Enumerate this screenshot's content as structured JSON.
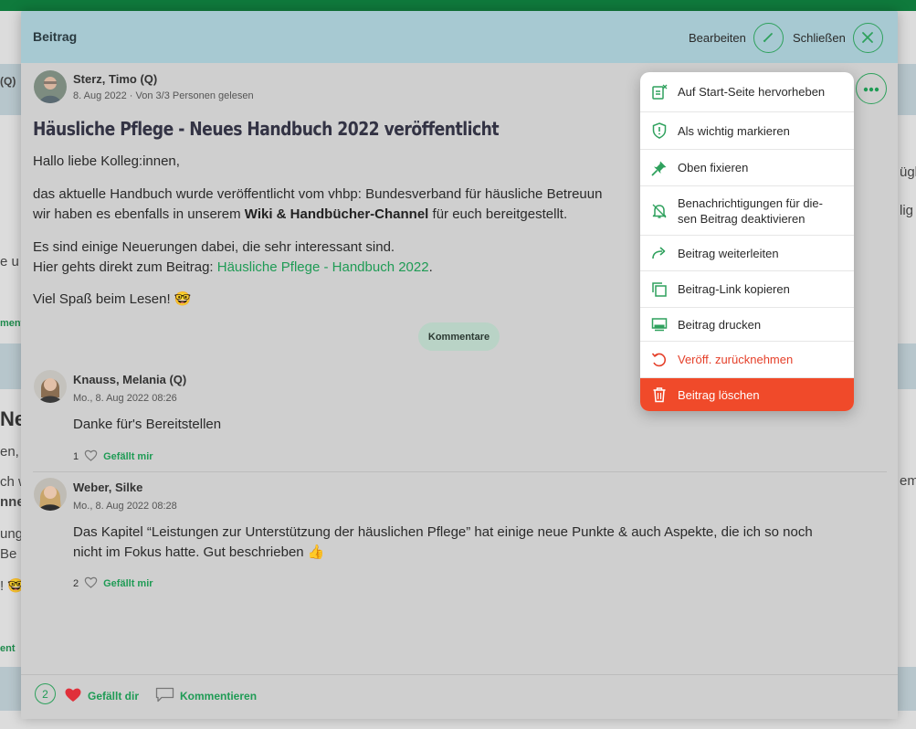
{
  "modal": {
    "title": "Beitrag",
    "edit_label": "Bearbeiten",
    "close_label": "Schließen"
  },
  "post": {
    "author": "Sterz, Timo (Q)",
    "date": "8. Aug 2022",
    "read_status": "Von 3/3 Personen gelesen",
    "headline": "Häusliche Pflege -  Neues Handbuch 2022 veröffentlicht",
    "greeting": "Hallo liebe Kolleg:innen,",
    "p1_line1": "das aktuelle Handbuch wurde veröffentlicht vom vhbp: Bundesverband für häusliche Betreuun",
    "p1_line2_pre": "wir haben es ebenfalls in unserem ",
    "p1_line2_bold": "Wiki & Handbücher-Channel",
    "p1_line2_post": " für euch bereitgestellt.",
    "p2_line1": "Es sind einige Neuerungen dabei, die sehr interessant sind.",
    "p2_line2_pre": "Hier gehts direkt zum Beitrag: ",
    "p2_link": "Häusliche Pflege -  Handbuch 2022",
    "p2_line2_post": ".",
    "closing": "Viel Spaß beim Lesen! 🤓",
    "comments_label": "Kommentare"
  },
  "comments": [
    {
      "author": "Knauss, Melania (Q)",
      "timestamp": "Mo., 8. Aug 2022 08:26",
      "text_line1": "Danke für's Bereitstellen",
      "text_line2": "",
      "likes": "1",
      "like_label": "Gefällt mir"
    },
    {
      "author": "Weber, Silke",
      "timestamp": "Mo., 8. Aug 2022 08:28",
      "text_line1": "Das Kapitel “Leistungen zur Unterstützung der häuslichen Pflege” hat einige neue Punkte & auch Aspekte, die ich so noch",
      "text_line2": "nicht im Fokus hatte. Gut beschrieben 👍",
      "likes": "2",
      "like_label": "Gefällt mir"
    }
  ],
  "footer": {
    "like_count": "2",
    "liked_label": "Gefällt dir",
    "comment_label": "Kommentieren"
  },
  "menu": {
    "items": [
      {
        "label": "Auf Start-Seite hervorheben",
        "icon": "highlight-icon"
      },
      {
        "label": "Als wichtig markieren",
        "icon": "shield-icon"
      },
      {
        "label": "Oben fixieren",
        "icon": "pin-icon"
      },
      {
        "label_line1": "Benachrichtigungen für die-",
        "label_line2": "sen Beitrag deaktivieren",
        "icon": "bell-off-icon"
      },
      {
        "label": "Beitrag weiterleiten",
        "icon": "forward-icon"
      },
      {
        "label": "Beitrag-Link kopieren",
        "icon": "copy-icon"
      },
      {
        "label": "Beitrag drucken",
        "icon": "print-icon"
      },
      {
        "label": "Veröff. zurücknehmen",
        "icon": "undo-icon"
      },
      {
        "label": "Beitrag löschen",
        "icon": "trash-icon"
      }
    ]
  },
  "background": {
    "frag_q": "(Q)",
    "frag_e_u": "e u",
    "frag_ment1": "ment",
    "frag_neu": "Neu",
    "frag_en": "en,",
    "frag_ch_w": "ch w",
    "frag_nne": "nne",
    "frag_unge": "unge",
    "frag_be": " Be",
    "frag_excl": "! 🤓",
    "frag_ment2": "ent",
    "frag_right1": "ügl",
    "frag_right2": "lig",
    "frag_right3": "em"
  },
  "colors": {
    "accent_green": "#2fa15d",
    "header_blue": "#a7c9d2",
    "danger_red": "#f04a2a",
    "heart_red": "#e0303a"
  }
}
